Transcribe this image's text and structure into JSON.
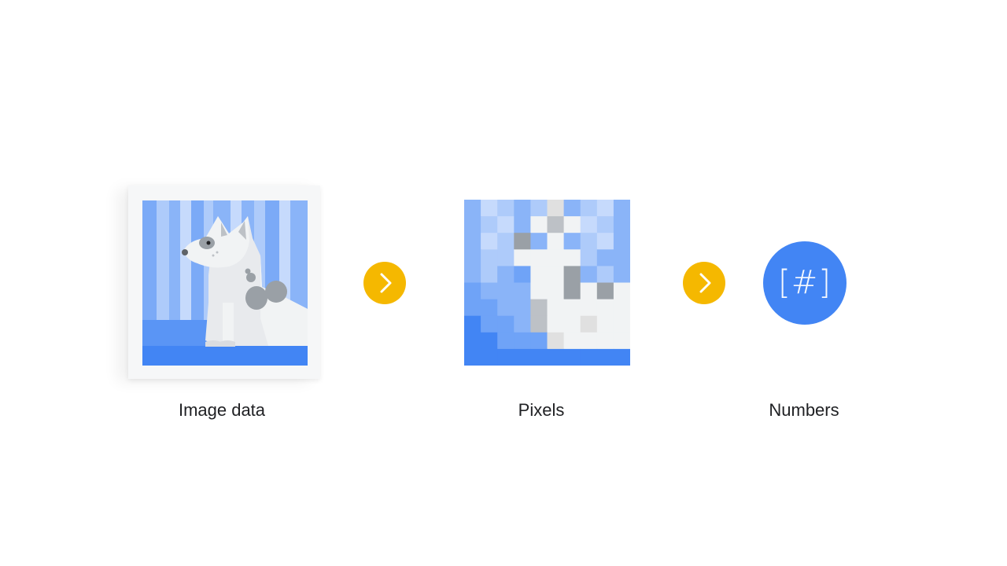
{
  "diagram": {
    "steps": [
      {
        "id": "image",
        "label": "Image data",
        "icon": "dog-photo-icon"
      },
      {
        "id": "pixels",
        "label": "Pixels",
        "icon": "pixelated-image-icon"
      },
      {
        "id": "numbers",
        "label": "Numbers",
        "icon": "hash-brackets-icon",
        "glyph": "[#]"
      }
    ],
    "connectors": [
      {
        "icon": "chevron-right-icon"
      },
      {
        "icon": "chevron-right-icon"
      }
    ]
  },
  "colors": {
    "arrow": "#f5b800",
    "numbers_circle": "#4285f4",
    "blue_light": "#aecbfa",
    "blue_mid": "#8ab4f8",
    "blue_dark": "#4285f4",
    "text": "#202124"
  }
}
